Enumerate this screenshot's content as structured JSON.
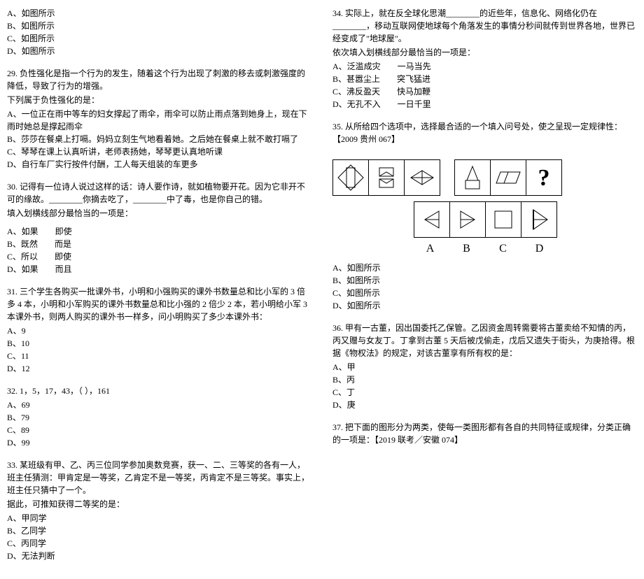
{
  "left": {
    "q28_opts": [
      "A、如图所示",
      "B、如图所示",
      "C、如图所示",
      "D、如图所示"
    ],
    "q29_stem1": "29. 负性强化是指一个行为的发生，随着这个行为出现了刺激的移去或刺激强度的降低，导致了行为的增强。",
    "q29_stem2": "下列属于负性强化的是：",
    "q29_opts": [
      "A、一位正在雨中等车的妇女撑起了雨伞，雨伞可以防止雨点落到她身上，现在下雨时她总是撑起雨伞",
      "B、莎莎在餐桌上打嗝。妈妈立刻生气地看着她。之后她在餐桌上就不敢打嗝了",
      "C、琴琴在课上认真听讲，老师表扬她，琴琴更认真地听课",
      "D、自行车厂实行按件付酬，工人每天组装的车更多"
    ],
    "q30_stem1": "30. 记得有一位诗人说过这样的话：诗人要作诗，就如植物要开花。因为它非开不可的缘故。________你摘去吃了，________中了毒，也是你自己的错。",
    "q30_stem2": "填入划横线部分最恰当的一项是：",
    "q30_opts": [
      "A、如果　　即使",
      "B、既然　　而是",
      "C、所以　　即使",
      "D、如果　　而且"
    ],
    "q31_stem": "31. 三个学生各购买一批课外书，小明和小强购买的课外书数量总和比小军的 3 倍多 4 本，小明和小军购买的课外书数量总和比小强的 2 倍少 2 本，若小明给小军 3 本课外书，则两人购买的课外书一样多，问小明购买了多少本课外书：",
    "q31_opts": [
      "A、9",
      "B、10",
      "C、11",
      "D、12"
    ],
    "q32_stem": "32. 1，5，17，43，（  ），161",
    "q32_opts": [
      "A、69",
      "B、79",
      "C、89",
      "D、99"
    ],
    "q33_stem1": "33. 某班级有甲、乙、丙三位同学参加奥数竞赛，获一、二、三等奖的各有一人，班主任猜测：甲肯定是一等奖，乙肯定不是一等奖，丙肯定不是三等奖。事实上，班主任只猜中了一个。",
    "q33_stem2": "据此，可推知获得二等奖的是：",
    "q33_opts": [
      "A、甲同学",
      "B、乙同学",
      "C、丙同学",
      "D、无法判断"
    ]
  },
  "right": {
    "q34_stem1": "34. 实际上，就在反全球化思潮________的近些年，信息化、网络化仍在________，移动互联网使地球每个角落发生的事情分秒间就传到世界各地，世界已经变成了\"地球屋\"。",
    "q34_stem2": "依次填入划横线部分最恰当的一项是：",
    "q34_opts": [
      "A、泛滥成灾　　一马当先",
      "B、甚嚣尘上　　突飞猛进",
      "C、沸反盈天　　快马加鞭",
      "D、无孔不入　　一日千里"
    ],
    "q35_stem": "35. 从所给四个选项中，选择最合适的一个填入问号处，使之呈现一定规律性：【2009 贵州 067】",
    "q35_opts": [
      "A、如图所示",
      "B、如图所示",
      "C、如图所示",
      "D、如图所示"
    ],
    "q35_labels": [
      "A",
      "B",
      "C",
      "D"
    ],
    "q36_stem": "36. 甲有一古董，因出国委托乙保管。乙因资金周转需要将古董卖给不知情的丙，丙又赠与女友丁。丁拿到古董 5 天后被戊偷走，戊后又遗失于街头，为庚拾得。根据《物权法》的规定，对该古董享有所有权的是：",
    "q36_opts": [
      "A、甲",
      "B、丙",
      "C、丁",
      "D、庚"
    ],
    "q37_stem": "37. 把下面的图形分为两类，使每一类图形都有各自的共同特征或规律，分类正确的一项是：【2019 联考／安徽 074】"
  }
}
